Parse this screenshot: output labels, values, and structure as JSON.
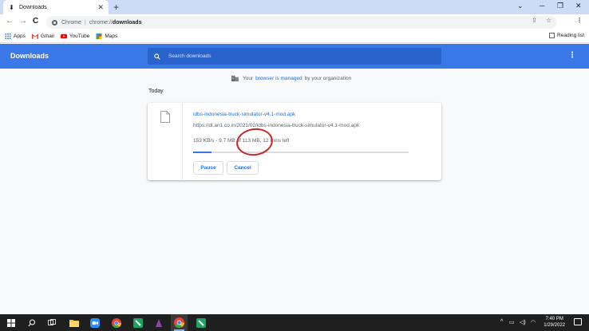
{
  "browser": {
    "tab": {
      "title": "Downloads",
      "icon": "download-icon"
    },
    "new_tab_label": "+",
    "omnibox": {
      "site_label": "Chrome",
      "separator": "|",
      "url_scheme": "chrome://",
      "url_host": "downloads"
    },
    "bookmarks": [
      {
        "label": "Apps",
        "icon": "apps-grid-icon"
      },
      {
        "label": "Gmail",
        "icon": "gmail-icon"
      },
      {
        "label": "YouTube",
        "icon": "youtube-icon"
      },
      {
        "label": "Maps",
        "icon": "maps-icon"
      }
    ],
    "reading_list_label": "Reading list"
  },
  "downloads_page": {
    "title": "Downloads",
    "search_placeholder": "Search downloads",
    "managed": {
      "prefix": "Your",
      "link": "browser is managed",
      "suffix": "by your organization"
    },
    "section_label": "Today",
    "item": {
      "file_name": "idbs-indonesia-truck-simulator-v4.1-mod.apk",
      "url": "https://dl.an1.co.in/2021/02/idbs-indonesia-truck-simulator-v4.1-mod.apk",
      "status": "153 KB/s - 9.7 MB of 113 MB, 12 mins left",
      "progress_fraction": 0.086,
      "pause_label": "Pause",
      "cancel_label": "Cancel"
    }
  },
  "annotation_color": "#c62828",
  "accent_color": "#3b78e7",
  "taskbar": {
    "time": "7:40 PM",
    "date": "1/29/2022",
    "tray_icons": [
      "chevron-up-icon",
      "battery-icon",
      "volume-icon",
      "wifi-icon"
    ]
  }
}
